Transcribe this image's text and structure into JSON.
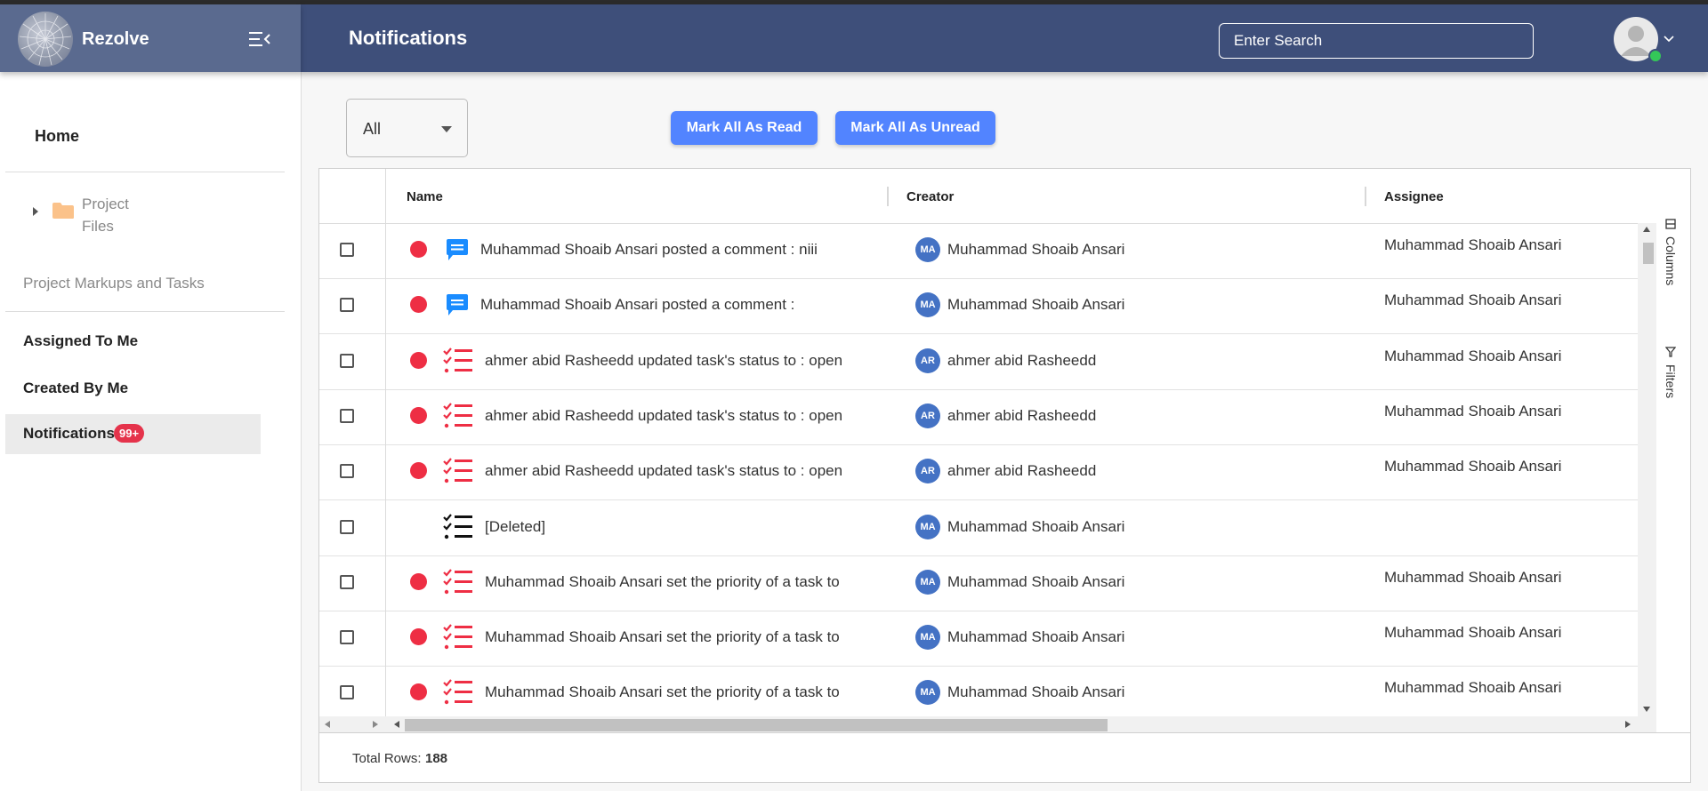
{
  "app": {
    "name": "Rezolve"
  },
  "header": {
    "title": "Notifications",
    "search_placeholder": "Enter Search"
  },
  "sidebar": {
    "home": "Home",
    "project_files": [
      "Project",
      "Files"
    ],
    "section_title": "Project Markups and Tasks",
    "items": [
      {
        "label": "Assigned To Me"
      },
      {
        "label": "Created By Me"
      },
      {
        "label": "Notifications",
        "badge": "99+",
        "active": true
      }
    ]
  },
  "toolbar": {
    "filter_value": "All",
    "mark_read": "Mark All As Read",
    "mark_unread": "Mark All As Unread"
  },
  "table": {
    "columns": [
      "Name",
      "Creator",
      "Assignee"
    ],
    "rows": [
      {
        "unread": true,
        "icon": "comment-icon",
        "name": "Muhammad Shoaib Ansari posted a comment : niii",
        "creator_initials": "MA",
        "creator": "Muhammad Shoaib Ansari",
        "assignee": "Muhammad Shoaib Ansari"
      },
      {
        "unread": true,
        "icon": "comment-icon",
        "name": "Muhammad Shoaib Ansari posted a comment :",
        "creator_initials": "MA",
        "creator": "Muhammad Shoaib Ansari",
        "assignee": "Muhammad Shoaib Ansari"
      },
      {
        "unread": true,
        "icon": "task-list-icon",
        "name": "ahmer abid Rasheedd updated task's status to : open",
        "creator_initials": "AR",
        "creator": "ahmer abid Rasheedd",
        "assignee": "Muhammad Shoaib Ansari"
      },
      {
        "unread": true,
        "icon": "task-list-icon",
        "name": "ahmer abid Rasheedd updated task's status to : open",
        "creator_initials": "AR",
        "creator": "ahmer abid Rasheedd",
        "assignee": "Muhammad Shoaib Ansari"
      },
      {
        "unread": true,
        "icon": "task-list-icon",
        "name": "ahmer abid Rasheedd updated task's status to : open",
        "creator_initials": "AR",
        "creator": "ahmer abid Rasheedd",
        "assignee": "Muhammad Shoaib Ansari"
      },
      {
        "unread": false,
        "icon": "task-list-icon",
        "name": "[Deleted]",
        "creator_initials": "MA",
        "creator": "Muhammad Shoaib Ansari",
        "assignee": ""
      },
      {
        "unread": true,
        "icon": "task-list-icon",
        "name": "Muhammad Shoaib Ansari set the priority of a task to",
        "creator_initials": "MA",
        "creator": "Muhammad Shoaib Ansari",
        "assignee": "Muhammad Shoaib Ansari"
      },
      {
        "unread": true,
        "icon": "task-list-icon",
        "name": "Muhammad Shoaib Ansari set the priority of a task to",
        "creator_initials": "MA",
        "creator": "Muhammad Shoaib Ansari",
        "assignee": "Muhammad Shoaib Ansari"
      },
      {
        "unread": true,
        "icon": "task-list-icon",
        "name": "Muhammad Shoaib Ansari set the priority of a task to",
        "creator_initials": "MA",
        "creator": "Muhammad Shoaib Ansari",
        "assignee": "Muhammad Shoaib Ansari"
      }
    ],
    "side_tabs": [
      "Columns",
      "Filters"
    ],
    "footer_label": "Total Rows:",
    "total_rows": "188"
  },
  "colors": {
    "brand": "#5a6a8f",
    "header": "#3e4f7a",
    "accent": "#5284ff",
    "unread": "#ee2e44",
    "comment": "#1a8cff",
    "task": "#ee2e44",
    "avatar": "#4472c4"
  }
}
